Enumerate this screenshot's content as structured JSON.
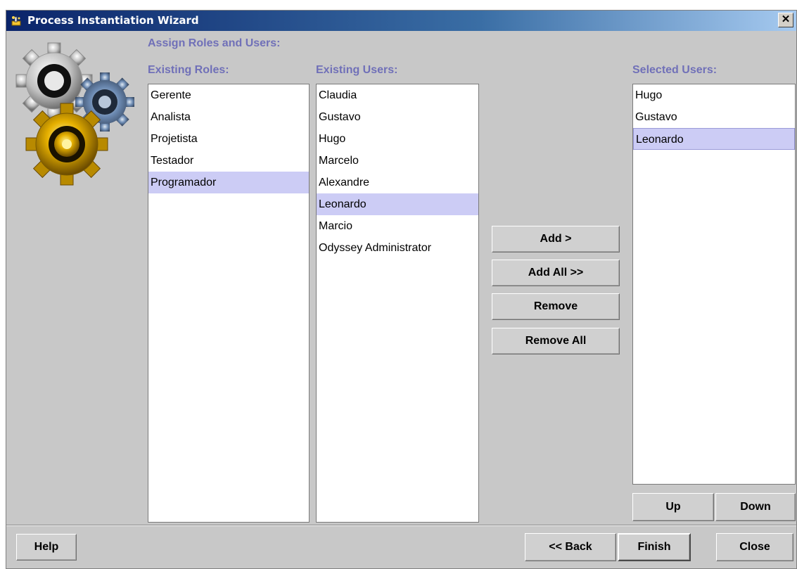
{
  "window": {
    "title": "Process Instantiation Wizard",
    "close_glyph": "✕"
  },
  "section_heading": "Assign Roles and Users:",
  "roles": {
    "heading": "Existing Roles:",
    "items": [
      "Gerente",
      "Analista",
      "Projetista",
      "Testador",
      "Programador"
    ],
    "selected": "Programador"
  },
  "existing_users": {
    "heading": "Existing Users:",
    "items": [
      "Claudia",
      "Gustavo",
      "Hugo",
      "Marcelo",
      "Alexandre",
      "Leonardo",
      "Marcio",
      "Odyssey Administrator"
    ],
    "selected": "Leonardo"
  },
  "selected_users": {
    "heading": "Selected Users:",
    "items": [
      "Hugo",
      "Gustavo",
      "Leonardo"
    ],
    "selected": "Leonardo"
  },
  "transfer_buttons": {
    "add": "Add >",
    "add_all": "Add All >>",
    "remove": "Remove",
    "remove_all": "Remove All"
  },
  "order_buttons": {
    "up": "Up",
    "down": "Down"
  },
  "footer": {
    "help": "Help",
    "back": "<< Back",
    "finish": "Finish",
    "close": "Close"
  },
  "icons": {
    "window_icon": "wizard-icon",
    "illustration": "gears-icon"
  },
  "colors": {
    "heading": "#7070b8",
    "selection": "#ccccf5",
    "titlebar": "#0a246a"
  }
}
